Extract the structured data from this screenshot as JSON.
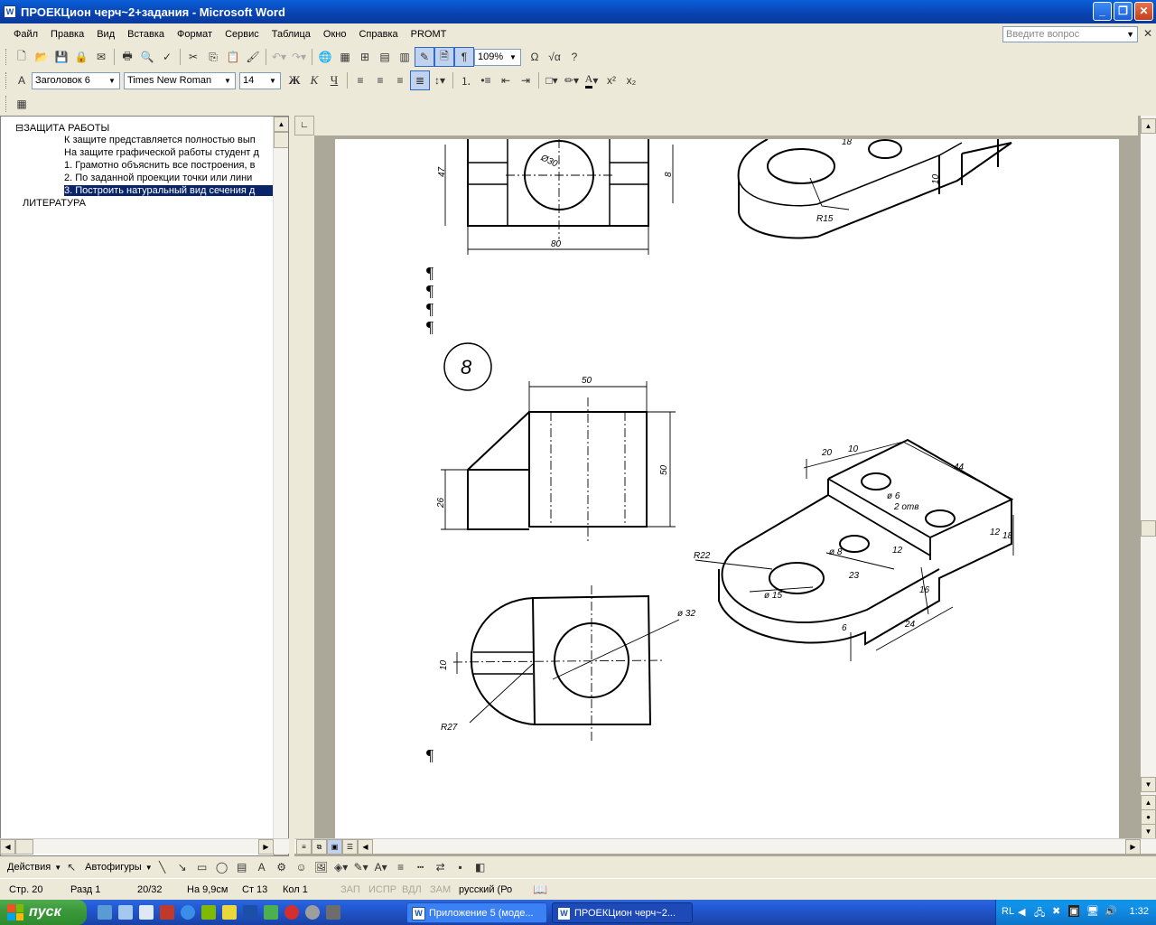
{
  "window": {
    "title": "ПРОЕКЦион черч~2+задания - Microsoft Word"
  },
  "menu": {
    "items": [
      "Файл",
      "Правка",
      "Вид",
      "Вставка",
      "Формат",
      "Сервис",
      "Таблица",
      "Окно",
      "Справка",
      "PROMT"
    ],
    "ask_placeholder": "Введите вопрос"
  },
  "toolbar": {
    "zoom": "109%",
    "style": "Заголовок 6",
    "font": "Times New Roman",
    "size": "14",
    "bold": "Ж",
    "italic": "К",
    "underline": "Ч"
  },
  "docmap": {
    "items": [
      "⊟ЗАЩИТА РАБОТЫ",
      "К защите представляется полностью вып",
      "На защите графической работы студент д",
      "1. Грамотно объяснить все построения, в",
      "2. По заданной проекции точки или лини",
      "3. Построить натуральный вид сечения д",
      "ЛИТЕРАТУРА"
    ]
  },
  "drawing": {
    "pilcrow": "¶",
    "top_dims": {
      "h47": "47",
      "d30": "Ø30",
      "d8": "8",
      "w80": "80",
      "d18": "18",
      "d10": "10",
      "r15": "R15"
    },
    "task_number": "8",
    "front_dims": {
      "w50": "50",
      "h50": "50",
      "h26": "26"
    },
    "plan_dims": {
      "d32": "ø 32",
      "h10": "10",
      "r27": "R27"
    },
    "iso_dims": {
      "d20": "20",
      "d10": "10",
      "d44": "44",
      "d6": "ø 6",
      "d2otv": "2 отв",
      "d12a": "12",
      "d18": "18",
      "d12b": "12",
      "r22": "R22",
      "d8": "ø 8",
      "d23": "23",
      "d15": "ø 15",
      "d16": "16",
      "d6b": "6",
      "d24": "24"
    }
  },
  "drawbar": {
    "actions": "Действия",
    "autoshapes": "Автофигуры"
  },
  "status": {
    "page": "Стр. 20",
    "section": "Разд 1",
    "pages": "20/32",
    "at": "На 9,9см",
    "line": "Ст 13",
    "col": "Кол 1",
    "rec": "ЗАП",
    "trk": "ИСПР",
    "ext": "ВДЛ",
    "ovr": "ЗАМ",
    "lang": "русский (Ро"
  },
  "taskbar": {
    "start": "пуск",
    "task1": "Приложение 5 (моде...",
    "task2": "ПРОЕКЦион черч~2...",
    "lang": "RL",
    "clock": "1:32"
  },
  "colors": {
    "titlebar": "#0a4bc4",
    "selection": "#0a246a",
    "taskbar": "#245edb",
    "start": "#3c9a3c"
  }
}
